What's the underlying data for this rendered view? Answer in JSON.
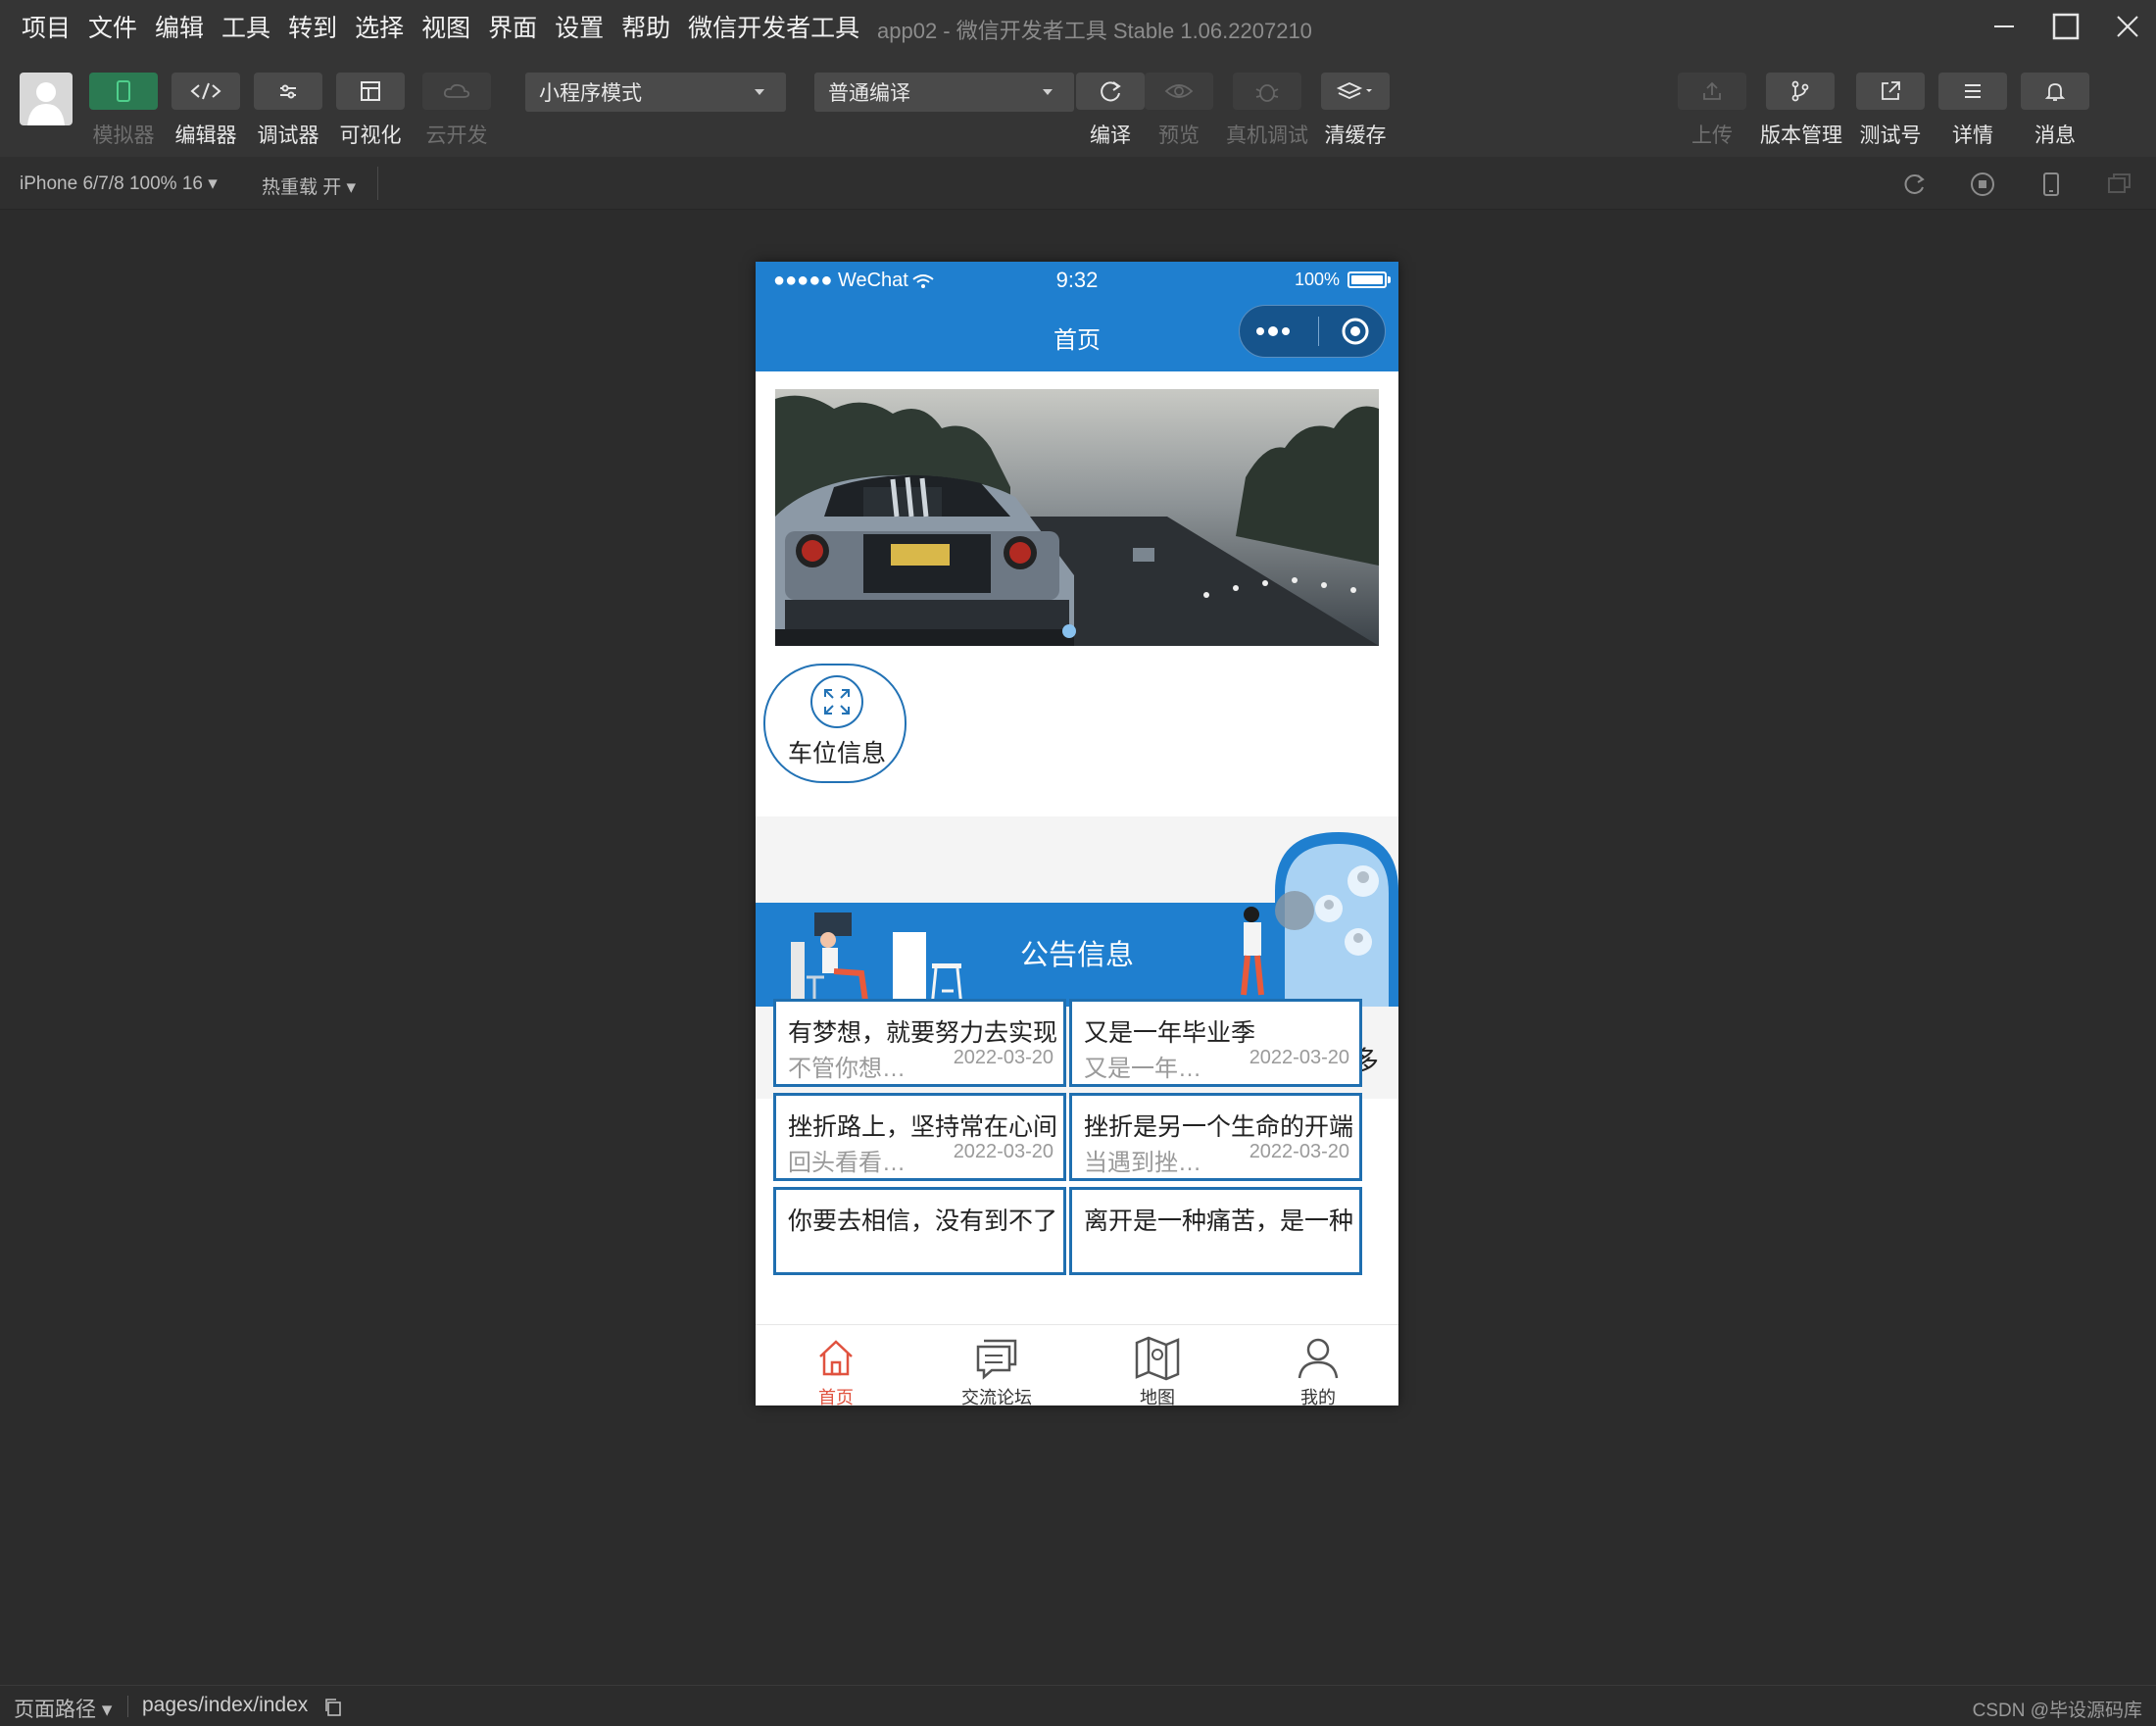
{
  "menu": [
    "项目",
    "文件",
    "编辑",
    "工具",
    "转到",
    "选择",
    "视图",
    "界面",
    "设置",
    "帮助",
    "微信开发者工具"
  ],
  "window_title": "app02 - 微信开发者工具 Stable 1.06.2207210",
  "toolbar": {
    "left_buttons": [
      {
        "label": "模拟器",
        "icon": "phone-icon",
        "active": true,
        "enabled": false
      },
      {
        "label": "编辑器",
        "icon": "code-icon",
        "active": false,
        "enabled": true
      },
      {
        "label": "调试器",
        "icon": "sliders-icon",
        "active": false,
        "enabled": true
      },
      {
        "label": "可视化",
        "icon": "layout-icon",
        "active": false,
        "enabled": true
      },
      {
        "label": "云开发",
        "icon": "cloud-icon",
        "active": false,
        "enabled": false
      }
    ],
    "mode_select": "小程序模式",
    "compile_select": "普通编译",
    "mid_buttons": [
      {
        "label": "编译",
        "icon": "refresh-icon",
        "enabled": true
      },
      {
        "label": "预览",
        "icon": "eye-icon",
        "enabled": false
      },
      {
        "label": "真机调试",
        "icon": "bug-icon",
        "enabled": false
      },
      {
        "label": "清缓存",
        "icon": "layers-icon",
        "enabled": true
      }
    ],
    "right_buttons": [
      {
        "label": "上传",
        "icon": "upload-icon",
        "enabled": false
      },
      {
        "label": "版本管理",
        "icon": "branch-icon",
        "enabled": true
      },
      {
        "label": "测试号",
        "icon": "external-link-icon",
        "enabled": true
      },
      {
        "label": "详情",
        "icon": "menu-icon",
        "enabled": true
      },
      {
        "label": "消息",
        "icon": "bell-icon",
        "enabled": true
      }
    ]
  },
  "subbar": {
    "device": "iPhone 6/7/8 100% 16 ▾",
    "hot_reload": "热重载 开 ▾"
  },
  "phone": {
    "status_left": "●●●●● WeChat",
    "time": "9:32",
    "battery": "100%",
    "nav_title": "首页",
    "category_label": "车位信息",
    "notice_title": "公告信息",
    "more_label": "查看更多",
    "cards": [
      {
        "title": "有梦想，就要努力去实现",
        "summary": "不管你想…",
        "date": "2022-03-20"
      },
      {
        "title": "又是一年毕业季",
        "summary": "又是一年…",
        "date": "2022-03-20"
      },
      {
        "title": "挫折路上，坚持常在心间",
        "summary": "回头看看…",
        "date": "2022-03-20"
      },
      {
        "title": "挫折是另一个生命的开端",
        "summary": "当遇到挫…",
        "date": "2022-03-20"
      },
      {
        "title": "你要去相信，没有到不了",
        "summary": "",
        "date": ""
      },
      {
        "title": "离开是一种痛苦，是一种",
        "summary": "",
        "date": ""
      }
    ],
    "tabs": [
      {
        "label": "首页",
        "icon": "home-icon",
        "active": true
      },
      {
        "label": "交流论坛",
        "icon": "chat-icon",
        "active": false
      },
      {
        "label": "地图",
        "icon": "map-icon",
        "active": false
      },
      {
        "label": "我的",
        "icon": "user-icon",
        "active": false
      }
    ],
    "colors": {
      "primary": "#1f7fcf",
      "active_tab": "#e0523f",
      "card_border": "#1f6fb0"
    }
  },
  "footer": {
    "path_label": "页面路径 ▾",
    "path": "pages/index/index",
    "watermark": "CSDN @毕设源码库"
  }
}
